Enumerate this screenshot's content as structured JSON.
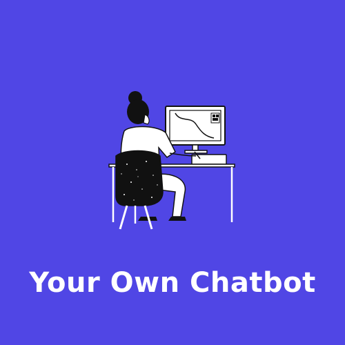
{
  "page": {
    "background_color": "#5046e5",
    "text_color": "#ffffff"
  },
  "illustration": {
    "icon": "person-at-computer-illustration"
  },
  "title": {
    "text": "Your Own Chatbot"
  }
}
